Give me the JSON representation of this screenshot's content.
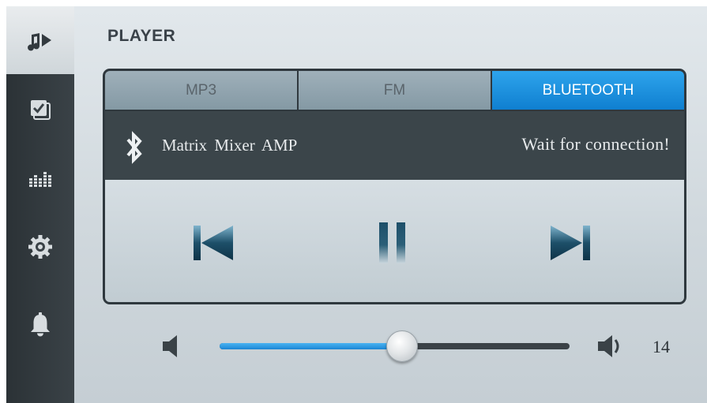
{
  "sidebar": {
    "items": [
      {
        "icon": "music-player-icon",
        "active": true
      },
      {
        "icon": "checklist-icon",
        "active": false
      },
      {
        "icon": "equalizer-icon",
        "active": false
      },
      {
        "icon": "gear-icon",
        "active": false
      },
      {
        "icon": "bell-icon",
        "active": false
      }
    ]
  },
  "page": {
    "title": "PLAYER"
  },
  "tabs": [
    {
      "label": "MP3",
      "active": false
    },
    {
      "label": "FM",
      "active": false
    },
    {
      "label": "BLUETOOTH",
      "active": true
    }
  ],
  "bluetooth": {
    "icon": "bluetooth-icon",
    "device_name": "Matrix  Mixer AMP",
    "status": "Wait for connection!"
  },
  "controls": {
    "previous_icon": "skip-previous-icon",
    "pause_icon": "pause-icon",
    "next_icon": "skip-next-icon"
  },
  "volume": {
    "value": "14",
    "level_fraction": 0.52,
    "low_icon": "volume-low-icon",
    "high_icon": "volume-high-icon"
  },
  "colors": {
    "accent": "#1b8ee0",
    "sidebar": "#2f373c",
    "panel": "#3a4449"
  }
}
